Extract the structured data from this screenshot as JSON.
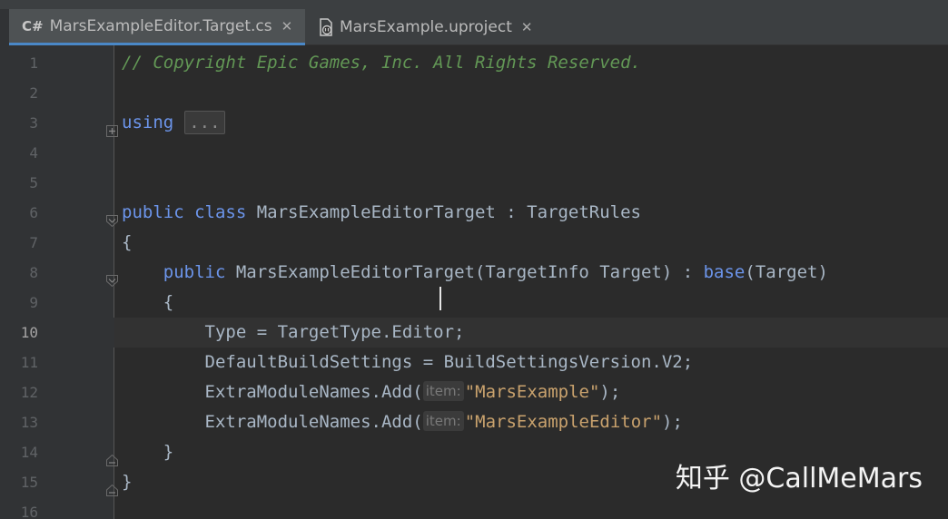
{
  "tabs": [
    {
      "icon": "csharp-icon",
      "icon_text": "C#",
      "label": "MarsExampleEditor.Target.cs",
      "active": true
    },
    {
      "icon": "uproject-file-icon",
      "label": "MarsExample.uproject",
      "active": false
    }
  ],
  "tab_close_glyph": "✕",
  "lines": [
    {
      "number": "1",
      "tokens": [
        {
          "t": "// Copyright Epic Games, Inc. All Rights Reserved.",
          "c": "comment"
        }
      ]
    },
    {
      "number": "2",
      "tokens": []
    },
    {
      "number": "3",
      "fold": "plus",
      "tokens": [
        {
          "t": "using",
          "c": "kw"
        }
      ],
      "folded": "..."
    },
    {
      "number": "4",
      "tokens": []
    },
    {
      "number": "5",
      "tokens": []
    },
    {
      "number": "6",
      "fold": "open",
      "tokens": [
        {
          "t": "public",
          "c": "kw"
        },
        {
          "t": " "
        },
        {
          "t": "class",
          "c": "kw"
        },
        {
          "t": " MarsExampleEditorTarget : TargetRules"
        }
      ]
    },
    {
      "number": "7",
      "tokens": [
        {
          "t": "{"
        }
      ]
    },
    {
      "number": "8",
      "fold": "open",
      "tokens": [
        {
          "t": "    "
        },
        {
          "t": "public",
          "c": "kw"
        },
        {
          "t": " MarsExampleEditorTarget(TargetInfo Target) : "
        },
        {
          "t": "base",
          "c": "kw"
        },
        {
          "t": "(Target)"
        }
      ]
    },
    {
      "number": "9",
      "tokens": [
        {
          "t": "    {"
        }
      ]
    },
    {
      "number": "10",
      "current": true,
      "tokens": [
        {
          "t": "        Type = TargetType.Editor;"
        }
      ]
    },
    {
      "number": "11",
      "tokens": [
        {
          "t": "        DefaultBuildSettings = BuildSettingsVersion.V2;"
        }
      ]
    },
    {
      "number": "12",
      "tokens": [
        {
          "t": "        ExtraModuleNames.Add("
        },
        {
          "t": "item:",
          "c": "hint"
        },
        {
          "t": "\"MarsExample\"",
          "c": "str"
        },
        {
          "t": ");"
        }
      ]
    },
    {
      "number": "13",
      "tokens": [
        {
          "t": "        ExtraModuleNames.Add("
        },
        {
          "t": "item:",
          "c": "hint"
        },
        {
          "t": "\"MarsExampleEditor\"",
          "c": "str"
        },
        {
          "t": ");"
        }
      ]
    },
    {
      "number": "14",
      "fold": "close",
      "tokens": [
        {
          "t": "    }"
        }
      ]
    },
    {
      "number": "15",
      "fold": "close",
      "tokens": [
        {
          "t": "}"
        }
      ]
    },
    {
      "number": "16",
      "tokens": []
    }
  ],
  "watermark": "知乎 @CallMeMars",
  "colors": {
    "background": "#2b2b2b",
    "gutter": "#313335",
    "comment": "#629755",
    "keyword": "#6c95eb",
    "string": "#c9a26d",
    "identifier": "#a9b7c6",
    "tab_active_underline": "#4a88c7"
  }
}
